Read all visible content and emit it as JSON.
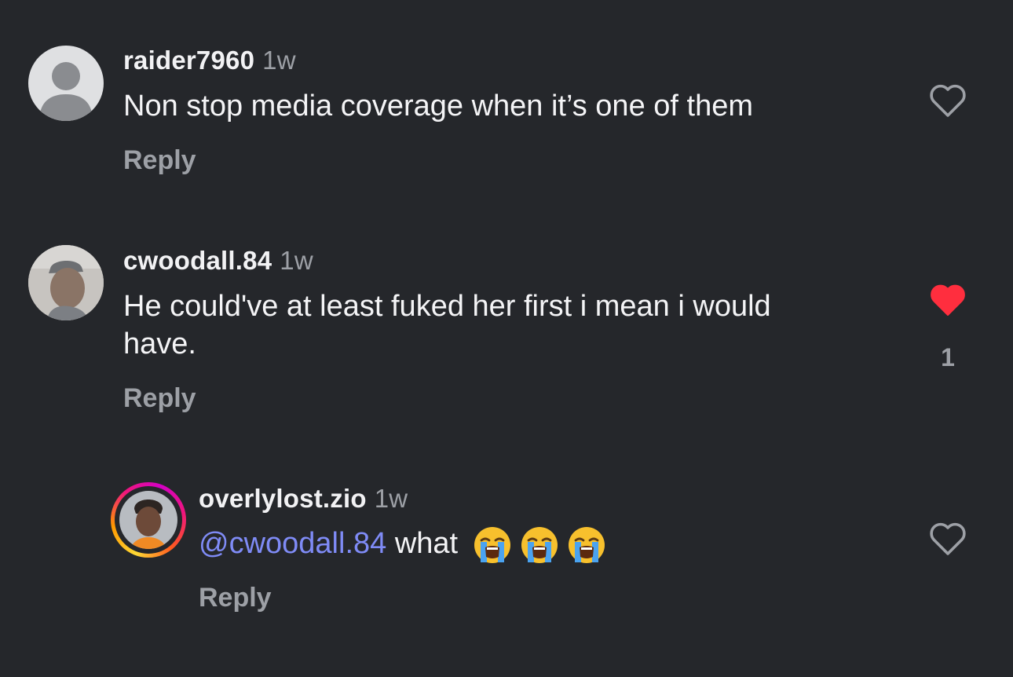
{
  "comments": [
    {
      "username": "raider7960",
      "time": "1w",
      "text": "Non stop media coverage when it’s one of them",
      "reply_label": "Reply",
      "liked": false
    },
    {
      "username": "cwoodall.84",
      "time": "1w",
      "text_line1": "He could've at least fuked her first i mean i would",
      "text_line2": "have.",
      "reply_label": "Reply",
      "liked": true,
      "like_count": "1"
    }
  ],
  "reply_thread": {
    "username": "overlylost.zio",
    "time": "1w",
    "mention": "@cwoodall.84",
    "text": "what",
    "emojis": [
      "loudly-crying-face-emoji",
      "loudly-crying-face-emoji",
      "loudly-crying-face-emoji"
    ],
    "reply_label": "Reply",
    "liked": false
  },
  "colors": {
    "background": "#25272b",
    "text": "#f4f4f6",
    "muted": "#9da0a6",
    "mention": "#7f8bf6",
    "liked_heart": "#ff2e3e"
  }
}
